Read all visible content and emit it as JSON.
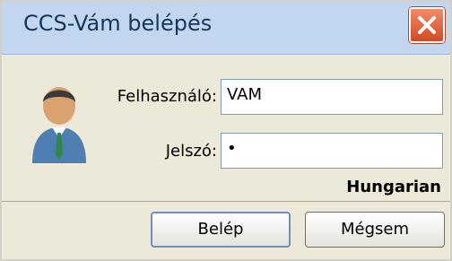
{
  "window": {
    "title": "CCS-Vám belépés"
  },
  "form": {
    "user_label": "Felhasználó:",
    "user_value": "VAM",
    "password_label": "Jelszó:",
    "password_value": "•"
  },
  "language": "Hungarian",
  "buttons": {
    "login": "Belép",
    "cancel": "Mégsem"
  },
  "icons": {
    "close": "close-icon",
    "avatar": "user-avatar-icon"
  },
  "colors": {
    "titlebar": "#c2d6ef",
    "close": "#d14a1f",
    "body": "#ece9d8"
  }
}
